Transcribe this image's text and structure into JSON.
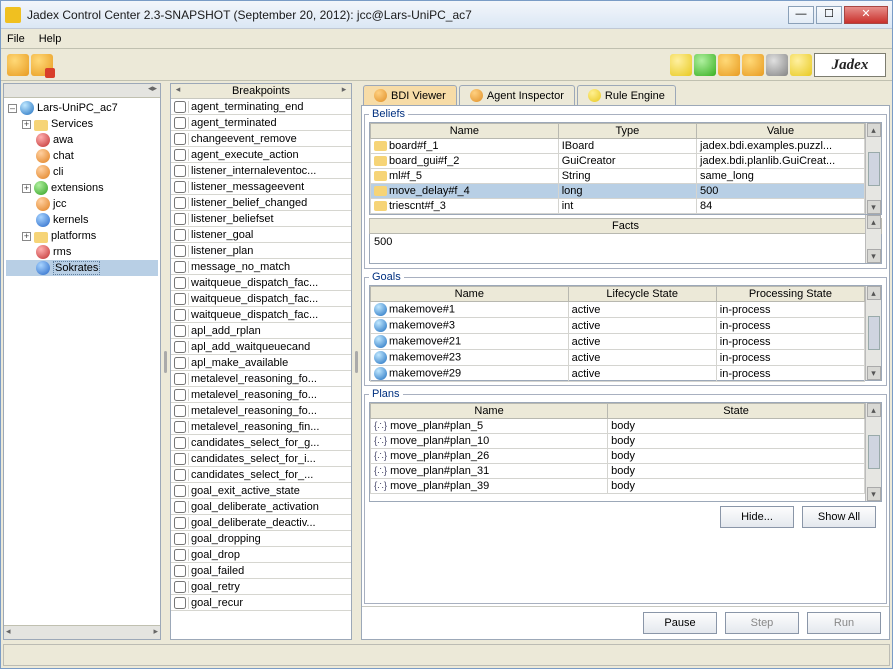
{
  "window": {
    "title": "Jadex Control Center 2.3-SNAPSHOT (September 20, 2012): jcc@Lars-UniPC_ac7"
  },
  "menu": {
    "file": "File",
    "help": "Help"
  },
  "logo": "Jadex",
  "tree": {
    "root": "Lars-UniPC_ac7",
    "items": [
      {
        "label": "Services"
      },
      {
        "label": "awa"
      },
      {
        "label": "chat"
      },
      {
        "label": "cli"
      },
      {
        "label": "extensions"
      },
      {
        "label": "jcc"
      },
      {
        "label": "kernels"
      },
      {
        "label": "platforms"
      },
      {
        "label": "rms"
      },
      {
        "label": "Sokrates",
        "selected": true
      }
    ]
  },
  "breakpoints": {
    "title": "Breakpoints",
    "items": [
      "agent_terminating_end",
      "agent_terminated",
      "changeevent_remove",
      "agent_execute_action",
      "listener_internaleventoc...",
      "listener_messageevent",
      "listener_belief_changed",
      "listener_beliefset",
      "listener_goal",
      "listener_plan",
      "message_no_match",
      "waitqueue_dispatch_fac...",
      "waitqueue_dispatch_fac...",
      "waitqueue_dispatch_fac...",
      "apl_add_rplan",
      "apl_add_waitqueuecand",
      "apl_make_available",
      "metalevel_reasoning_fo...",
      "metalevel_reasoning_fo...",
      "metalevel_reasoning_fo...",
      "metalevel_reasoning_fin...",
      "candidates_select_for_g...",
      "candidates_select_for_i...",
      "candidates_select_for_...",
      "goal_exit_active_state",
      "goal_deliberate_activation",
      "goal_deliberate_deactiv...",
      "goal_dropping",
      "goal_drop",
      "goal_failed",
      "goal_retry",
      "goal_recur"
    ]
  },
  "tabs": {
    "bdi": "BDI Viewer",
    "inspector": "Agent Inspector",
    "rule": "Rule Engine"
  },
  "beliefs": {
    "legend": "Beliefs",
    "headers": {
      "name": "Name",
      "type": "Type",
      "value": "Value"
    },
    "rows": [
      {
        "name": "board#f_1",
        "type": "IBoard",
        "value": "jadex.bdi.examples.puzzl..."
      },
      {
        "name": "board_gui#f_2",
        "type": "GuiCreator",
        "value": "jadex.bdi.planlib.GuiCreat..."
      },
      {
        "name": "ml#f_5",
        "type": "String",
        "value": "same_long"
      },
      {
        "name": "move_delay#f_4",
        "type": "long",
        "value": "500",
        "selected": true
      },
      {
        "name": "triescnt#f_3",
        "type": "int",
        "value": "84"
      }
    ],
    "facts_label": "Facts",
    "facts_value": "500"
  },
  "goals": {
    "legend": "Goals",
    "headers": {
      "name": "Name",
      "life": "Lifecycle State",
      "proc": "Processing State"
    },
    "rows": [
      {
        "name": "makemove#1",
        "life": "active",
        "proc": "in-process"
      },
      {
        "name": "makemove#3",
        "life": "active",
        "proc": "in-process"
      },
      {
        "name": "makemove#21",
        "life": "active",
        "proc": "in-process"
      },
      {
        "name": "makemove#23",
        "life": "active",
        "proc": "in-process"
      },
      {
        "name": "makemove#29",
        "life": "active",
        "proc": "in-process"
      }
    ]
  },
  "plans": {
    "legend": "Plans",
    "headers": {
      "name": "Name",
      "state": "State"
    },
    "rows": [
      {
        "name": "move_plan#plan_5",
        "state": "body"
      },
      {
        "name": "move_plan#plan_10",
        "state": "body"
      },
      {
        "name": "move_plan#plan_26",
        "state": "body"
      },
      {
        "name": "move_plan#plan_31",
        "state": "body"
      },
      {
        "name": "move_plan#plan_39",
        "state": "body"
      }
    ]
  },
  "buttons": {
    "hide": "Hide...",
    "showall": "Show All",
    "pause": "Pause",
    "step": "Step",
    "run": "Run"
  }
}
